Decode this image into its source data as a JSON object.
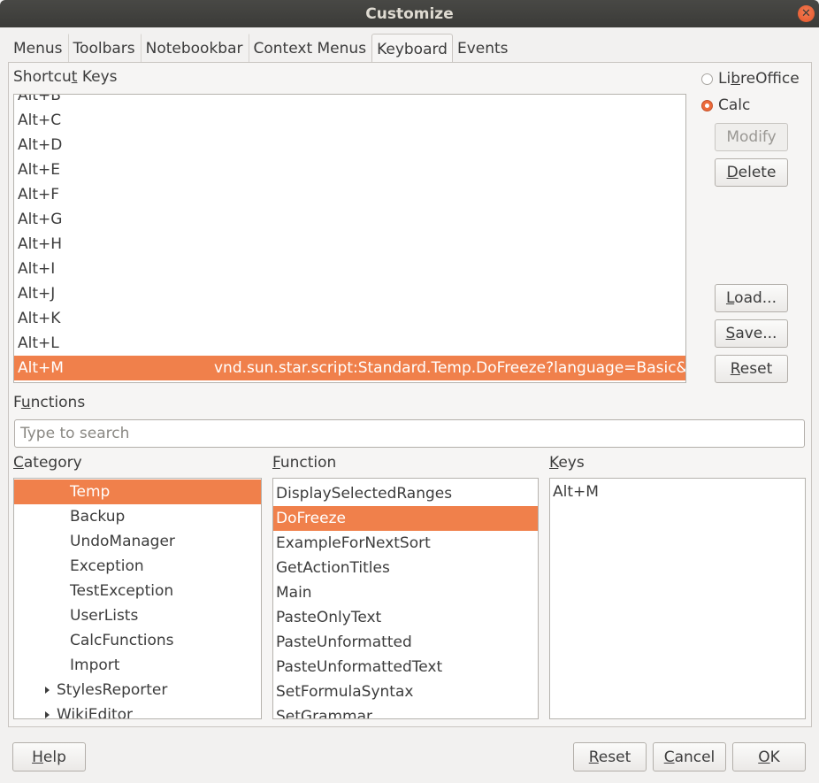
{
  "window": {
    "title": "Customize"
  },
  "tabs": [
    "Menus",
    "Toolbars",
    "Notebookbar",
    "Context Menus",
    "Keyboard",
    "Events"
  ],
  "active_tab": "Keyboard",
  "shortcut": {
    "label_pre": "Shortcu",
    "label_ul": "t",
    "label_post": " Keys",
    "rows": [
      {
        "key": "Alt+B",
        "func": ""
      },
      {
        "key": "Alt+C",
        "func": ""
      },
      {
        "key": "Alt+D",
        "func": ""
      },
      {
        "key": "Alt+E",
        "func": ""
      },
      {
        "key": "Alt+F",
        "func": ""
      },
      {
        "key": "Alt+G",
        "func": ""
      },
      {
        "key": "Alt+H",
        "func": ""
      },
      {
        "key": "Alt+I",
        "func": ""
      },
      {
        "key": "Alt+J",
        "func": ""
      },
      {
        "key": "Alt+K",
        "func": ""
      },
      {
        "key": "Alt+L",
        "func": ""
      },
      {
        "key": "Alt+M",
        "func": "vnd.sun.star.script:Standard.Temp.DoFreeze?language=Basic&lo"
      }
    ],
    "selected_key": "Alt+M"
  },
  "scope": {
    "libreoffice_pre": "Li",
    "libreoffice_ul": "b",
    "libreoffice_post": "reOffice",
    "calc": "Calc",
    "selected": "Calc"
  },
  "side_buttons": {
    "modify": "Modify",
    "delete_ul": "D",
    "delete_post": "elete",
    "load_ul": "L",
    "load_post": "oad...",
    "save_ul": "S",
    "save_post": "ave...",
    "reset_ul": "R",
    "reset_post": "eset"
  },
  "functions": {
    "label_pre": "F",
    "label_ul": "u",
    "label_post": "nctions",
    "search_placeholder": "Type to search"
  },
  "category": {
    "label_ul": "C",
    "label_post": "ategory",
    "items": [
      {
        "label": "Temp",
        "expander": false,
        "indent": 2,
        "selected": true
      },
      {
        "label": "Backup",
        "expander": false,
        "indent": 2,
        "selected": false
      },
      {
        "label": "UndoManager",
        "expander": false,
        "indent": 2,
        "selected": false
      },
      {
        "label": "Exception",
        "expander": false,
        "indent": 2,
        "selected": false
      },
      {
        "label": "TestException",
        "expander": false,
        "indent": 2,
        "selected": false
      },
      {
        "label": "UserLists",
        "expander": false,
        "indent": 2,
        "selected": false
      },
      {
        "label": "CalcFunctions",
        "expander": false,
        "indent": 2,
        "selected": false
      },
      {
        "label": "Import",
        "expander": false,
        "indent": 2,
        "selected": false
      },
      {
        "label": "StylesReporter",
        "expander": true,
        "indent": 1,
        "selected": false
      },
      {
        "label": "WikiEditor",
        "expander": true,
        "indent": 1,
        "selected": false
      }
    ]
  },
  "function": {
    "label_ul": "F",
    "label_post": "unction",
    "items": [
      "DisplaySelectedRanges",
      "DoFreeze",
      "ExampleForNextSort",
      "GetActionTitles",
      "Main",
      "PasteOnlyText",
      "PasteUnformatted",
      "PasteUnformattedText",
      "SetFormulaSyntax",
      "SetGrammar"
    ],
    "selected": "DoFreeze"
  },
  "keys": {
    "label_ul": "K",
    "label_post": "eys",
    "items": [
      "Alt+M"
    ]
  },
  "footer": {
    "help_ul": "H",
    "help_post": "elp",
    "reset_ul": "R",
    "reset_post": "eset",
    "cancel_ul": "C",
    "cancel_post": "ancel",
    "ok_ul": "O",
    "ok_post": "K"
  },
  "colors": {
    "accent": "#f0804b",
    "titlebar": "#3b3b38",
    "background": "#f2f1f0"
  }
}
